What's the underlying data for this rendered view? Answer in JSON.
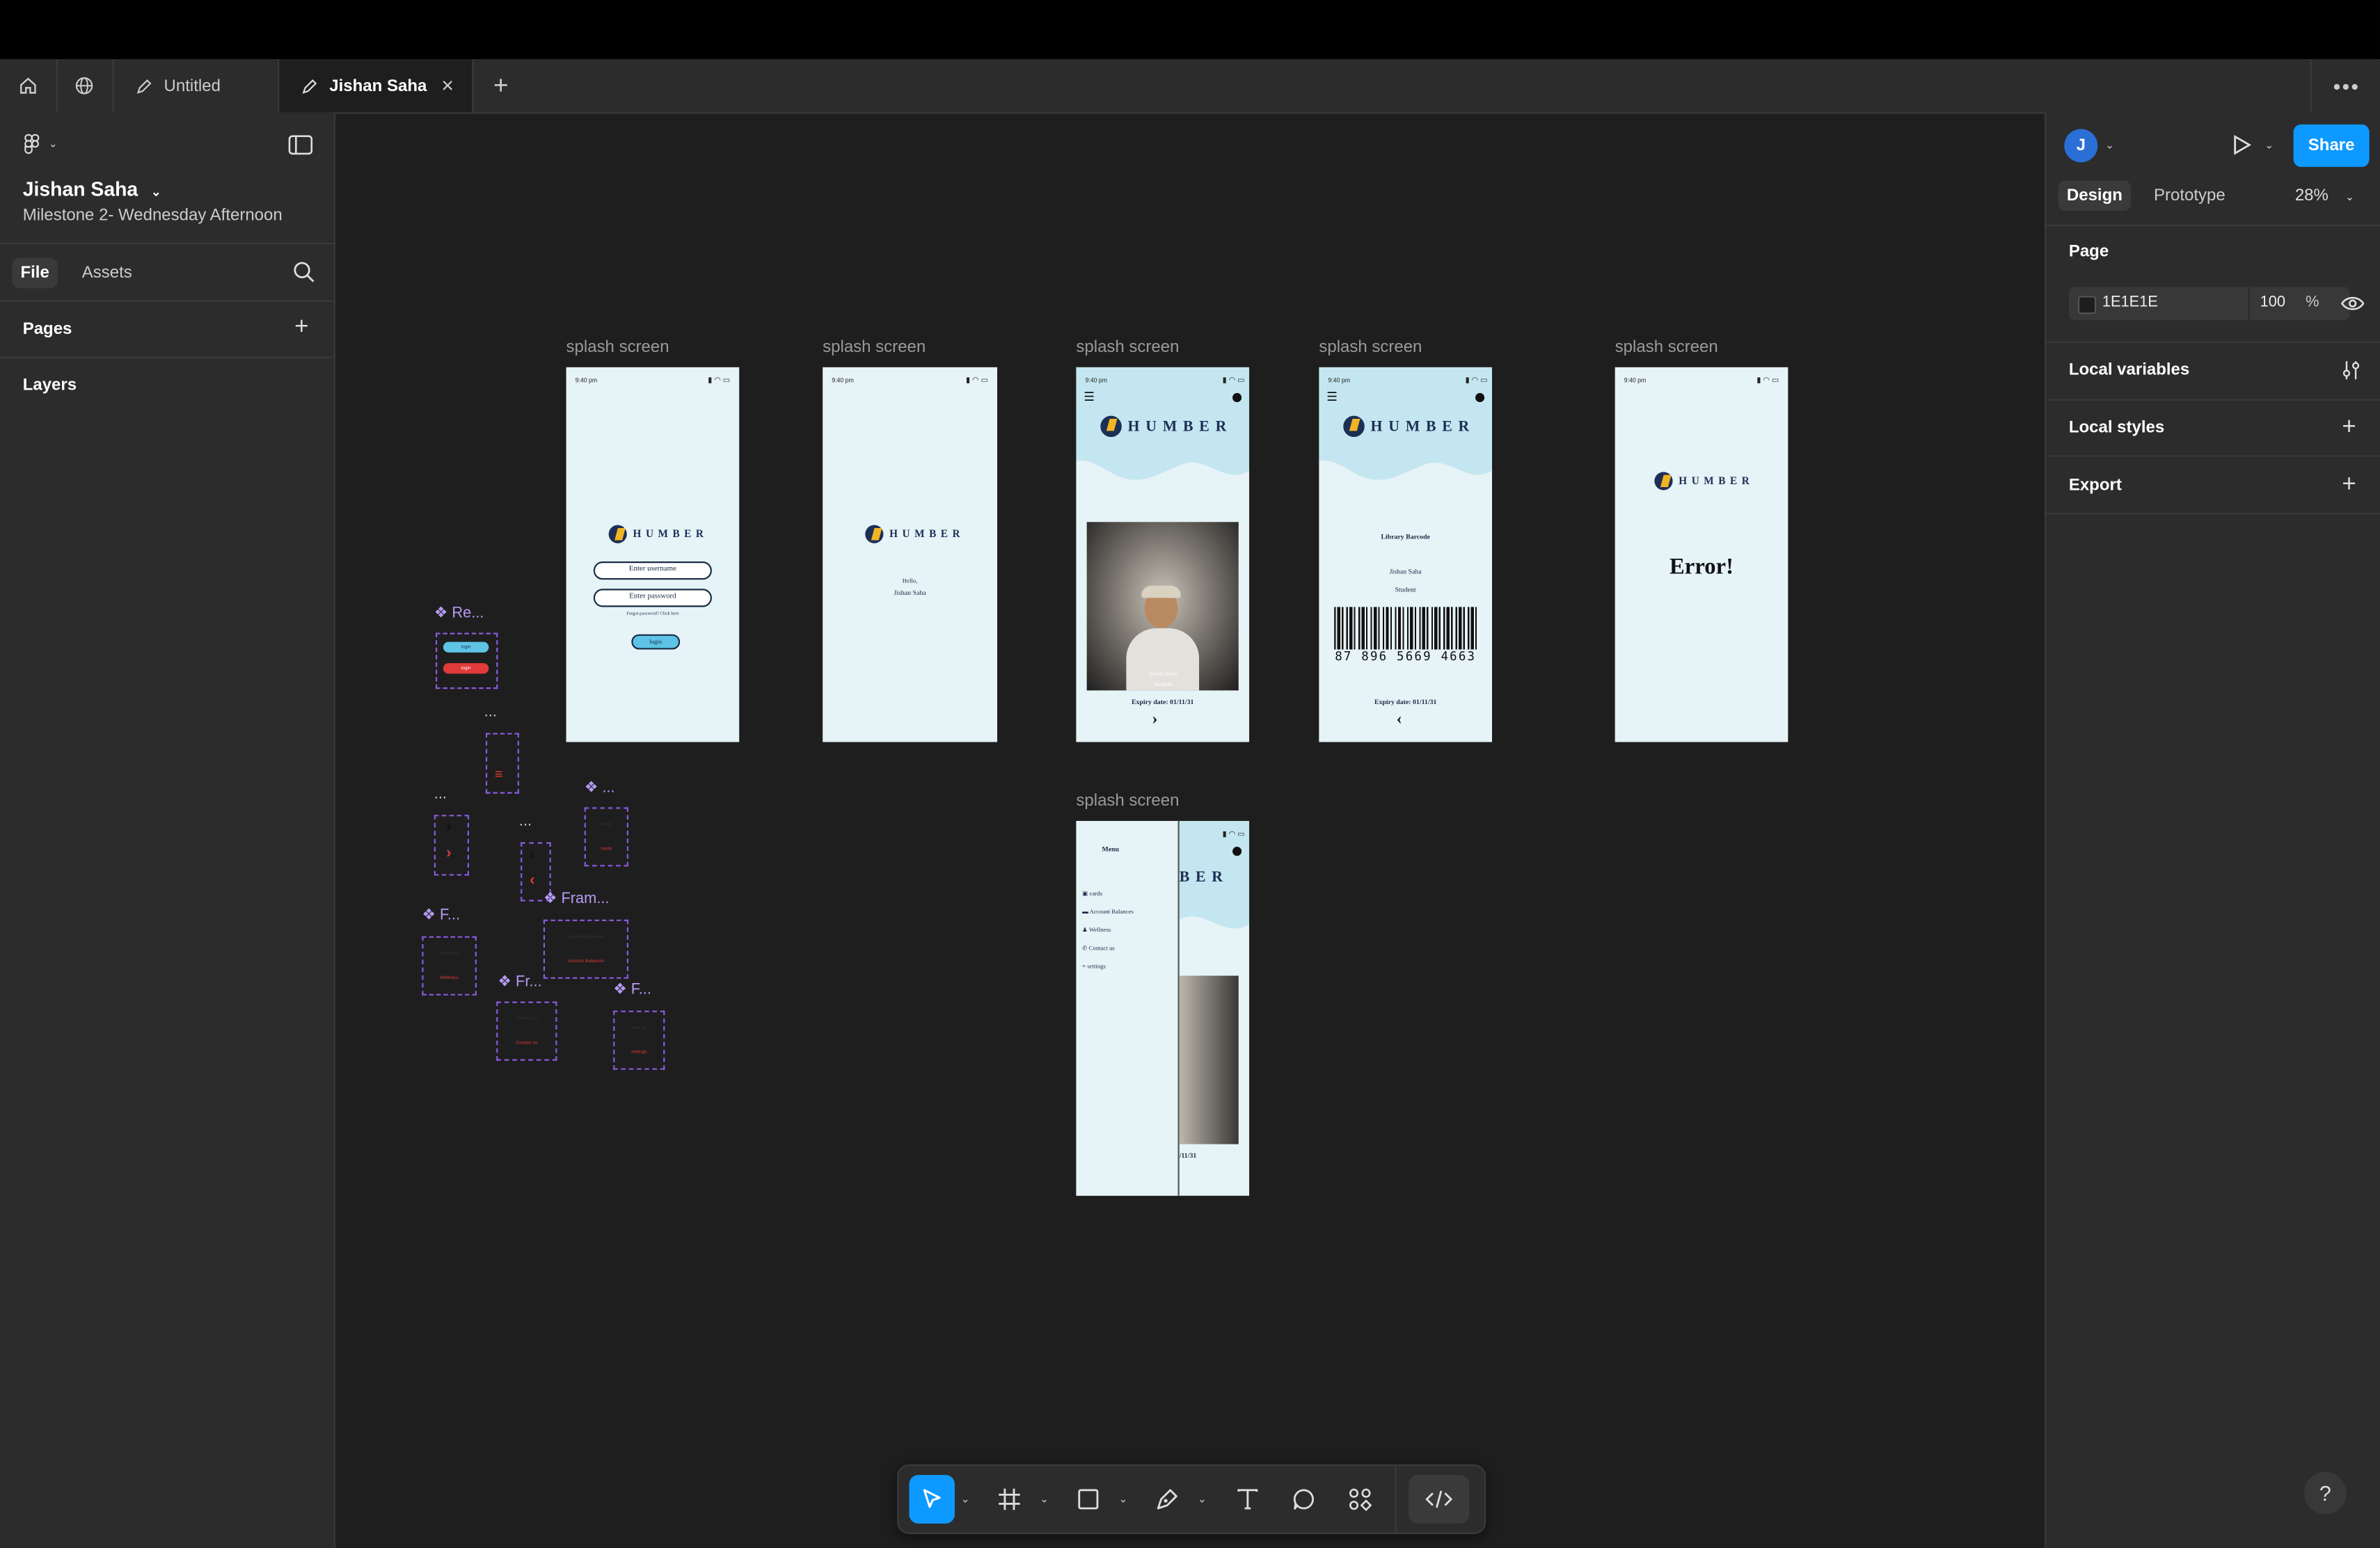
{
  "tabs": {
    "untitled": "Untitled",
    "active": "Jishan Saha"
  },
  "file": {
    "title": "Jishan Saha",
    "subtitle": "Milestone 2- Wednesday Afternoon"
  },
  "left": {
    "file_tab": "File",
    "assets_tab": "Assets",
    "pages": "Pages",
    "layers": "Layers"
  },
  "right": {
    "avatar_initial": "J",
    "share": "Share",
    "design_tab": "Design",
    "prototype_tab": "Prototype",
    "zoom": "28%",
    "page_heading": "Page",
    "page_color": "1E1E1E",
    "opacity": "100",
    "opacity_unit": "%",
    "local_variables": "Local variables",
    "local_styles": "Local styles",
    "export": "Export",
    "help": "?"
  },
  "canvas": {
    "frame_label": "splash screen",
    "statusbar_time": "9:40 pm",
    "brand": "HUMBER",
    "login": {
      "username_placeholder": "Enter username",
      "password_placeholder": "Enter password",
      "forgot": "Forgot password? Click here",
      "button": "login"
    },
    "welcome": {
      "hello": "Hello,",
      "name": "Jishan Saha"
    },
    "card": {
      "name": "Jishan Saha",
      "role": "Student",
      "expiry": "Expiry date: 01/11/31"
    },
    "barcode": {
      "title": "Library Barcode",
      "name": "Jishan Saha",
      "role": "Student",
      "number": "87 896 5669 4663",
      "expiry": "Expiry date: 01/11/31"
    },
    "error_text": "Error!",
    "menu": {
      "title": "Menu",
      "items": [
        "cards",
        "Account Balances",
        "Wellness",
        "Contact us",
        "settings"
      ],
      "expiry_fragment": "/11/31",
      "brand_fragment": "BER"
    },
    "components": {
      "re": "Re...",
      "ellipsis": "...",
      "fram": "Fram...",
      "f1": "F...",
      "fr": "Fr...",
      "f2": "F...",
      "small_login": "login",
      "small_cards": "cards",
      "small_account": "Account Balances",
      "small_wellness": "Wellness",
      "small_contact": "Contact us",
      "small_settings": "settings"
    }
  },
  "colors": {
    "canvas_bg": "#1E1E1E",
    "panel_bg": "#2C2C2C",
    "accent": "#0D99FF",
    "component": "#B59BF4",
    "phone_bg": "#E6F3F7",
    "brand_navy": "#1D2F55",
    "brand_gold": "#F2B423"
  }
}
